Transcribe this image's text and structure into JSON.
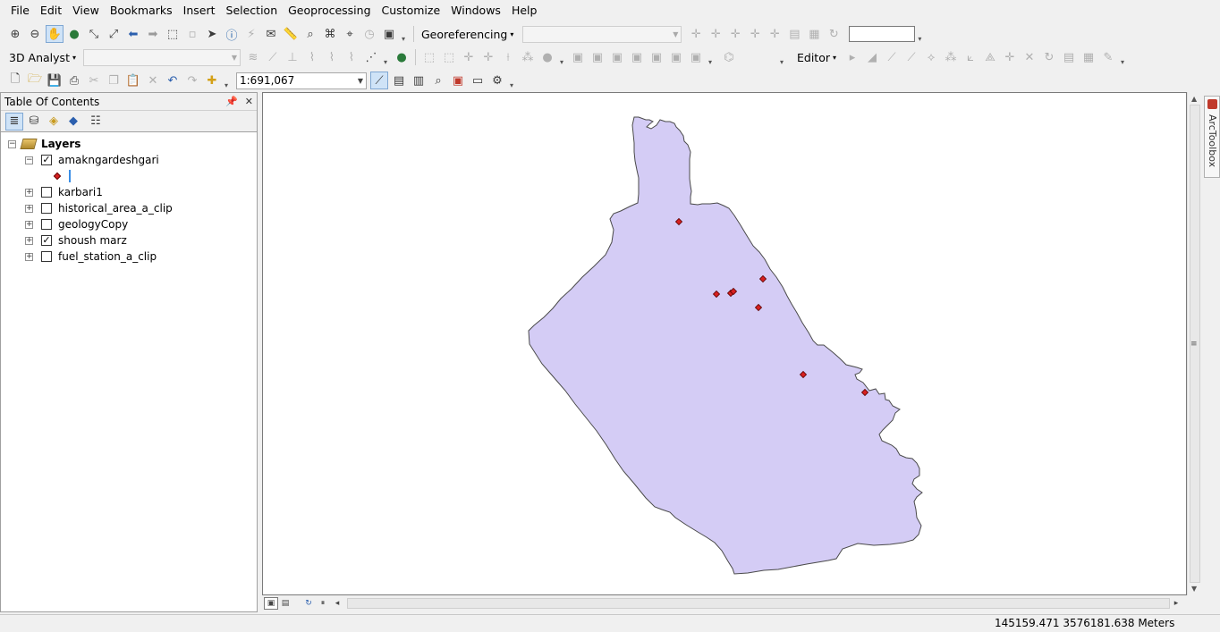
{
  "menu": [
    "File",
    "Edit",
    "View",
    "Bookmarks",
    "Insert",
    "Selection",
    "Geoprocessing",
    "Customize",
    "Windows",
    "Help"
  ],
  "toolbar1": {
    "georeferencing_label": "Georeferencing",
    "georef_layer_value": "",
    "rotate_value": ""
  },
  "toolbar2": {
    "analyst_label": "3D Analyst",
    "analyst_layer_value": "",
    "editor_label": "Editor"
  },
  "toolbar3": {
    "scale_value": "1:691,067"
  },
  "toc": {
    "title": "Table Of Contents",
    "root_label": "Layers",
    "layers": [
      {
        "name": "amakngardeshgari",
        "checked": true,
        "expanded": true
      },
      {
        "name": "karbari1",
        "checked": false,
        "expanded": false
      },
      {
        "name": "historical_area_a_clip",
        "checked": false,
        "expanded": false
      },
      {
        "name": "geologyCopy",
        "checked": false,
        "expanded": false
      },
      {
        "name": "shoush marz",
        "checked": true,
        "expanded": false
      },
      {
        "name": "fuel_station_a_clip",
        "checked": false,
        "expanded": false
      }
    ]
  },
  "map": {
    "polygon_fill": "#d4ccf5",
    "polygon_stroke": "#4a4a4a",
    "point_color": "#d62020",
    "point_count": 8
  },
  "side_tab": {
    "label": "ArcToolbox"
  },
  "status": {
    "coordinates": "145159.471  3576181.638 Meters"
  }
}
